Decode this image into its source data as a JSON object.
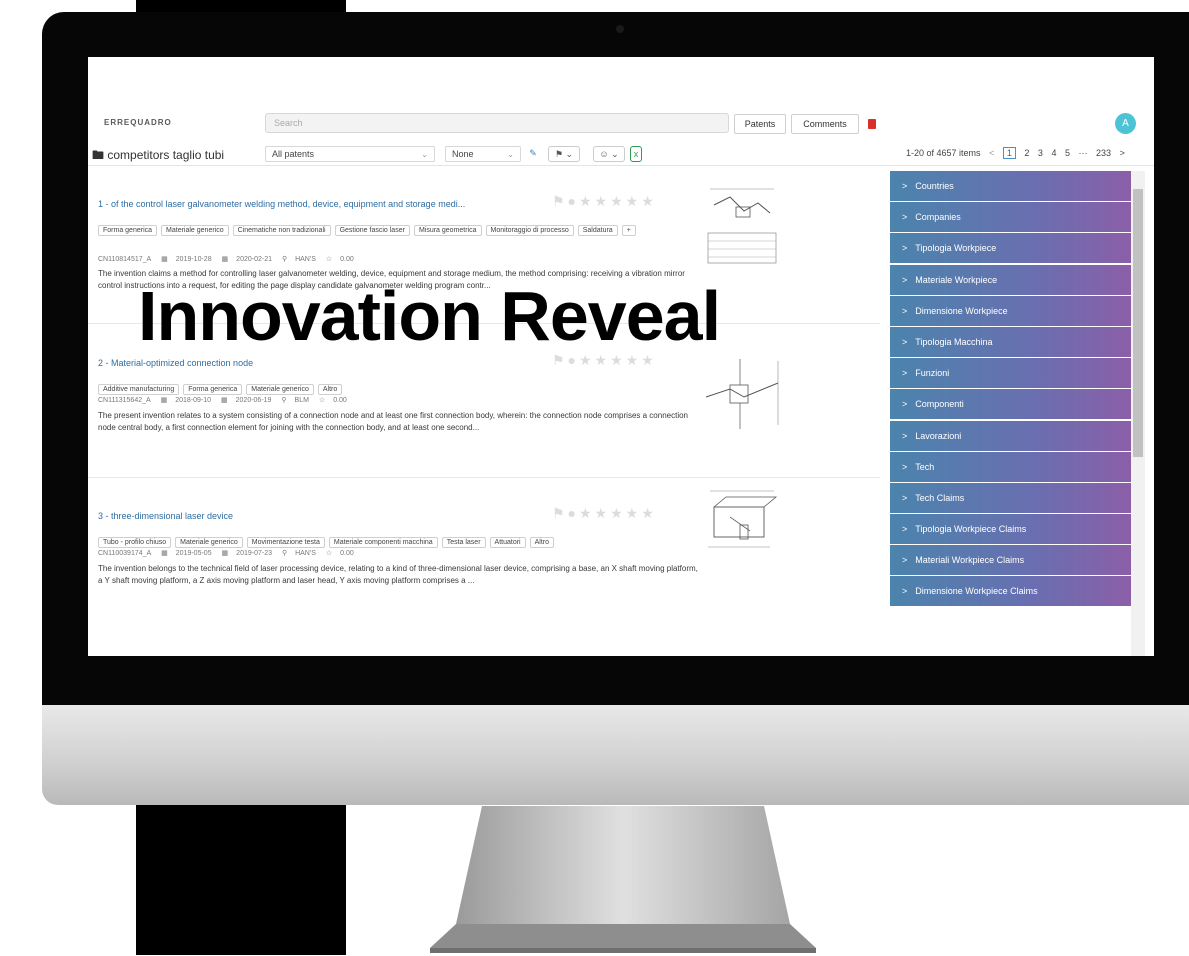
{
  "app": {
    "logo": "ERREQUADRO"
  },
  "header": {
    "search_placeholder": "Search",
    "patents_button": "Patents",
    "comments_button": "Comments",
    "avatar_initial": "A"
  },
  "toolbar": {
    "folder_name": "competitors taglio tubi",
    "filter_select": "All patents",
    "sort_select": "None",
    "pagination": {
      "summary": "1-20 of 4657 items",
      "prev": "<",
      "pages": [
        "1",
        "2",
        "3",
        "4",
        "5"
      ],
      "current": "1",
      "ellipsis": "···",
      "last": "233",
      "next": ">"
    }
  },
  "patents": [
    {
      "title": "1 - of the control laser galvanometer welding method, device, equipment and storage medi...",
      "tags": [
        "Forma generica",
        "Materiale generico",
        "Cinematiche non tradizionali",
        "Gestione fascio laser",
        "Misura geometrica",
        "Monitoraggio di processo",
        "Saldatura",
        "+"
      ],
      "number": "CN110814517_A",
      "filed": "2019-10-28",
      "published": "2020-02-21",
      "owner": "HAN'S",
      "score": "0.00",
      "abstract": "The invention claims a method for controlling laser galvanometer welding, device, equipment and storage medium, the method comprising: receiving a vibration mirror control instructions into a request, for editing the page display candidate galvanometer welding program contr..."
    },
    {
      "title": "2 - Material-optimized connection node",
      "tags": [
        "Additive manufacturing",
        "Forma generica",
        "Materiale generico",
        "Altro"
      ],
      "number": "CN111315642_A",
      "filed": "2018-09-10",
      "published": "2020-06-19",
      "owner": "BLM",
      "score": "0.00",
      "abstract": "The present invention relates to a system consisting of a connection node and at least one first connection body, wherein: the connection node comprises a connection node central body, a first connection element for joining with the connection body, and at least one second..."
    },
    {
      "title": "3 - three-dimensional laser device",
      "tags": [
        "Tubo - profilo chiuso",
        "Materiale generico",
        "Movimentazione testa",
        "Materiale componenti macchina",
        "Testa laser",
        "Attuatori",
        "Altro"
      ],
      "number": "CN110039174_A",
      "filed": "2019-05-05",
      "published": "2019-07-23",
      "owner": "HAN'S",
      "score": "0.00",
      "abstract": "The invention belongs to the technical field of laser processing device, relating to a kind of three-dimensional laser device, comprising a base, an X shaft moving platform, a Y shaft moving platform, a Z axis moving platform and laser head, Y axis moving platform comprises a ..."
    }
  ],
  "sidebar": {
    "items": [
      "Countries",
      "Companies",
      "Tipologia Workpiece",
      "Materiale Workpiece",
      "Dimensione Workpiece",
      "Tipologia Macchina",
      "Funzioni",
      "Componenti",
      "Lavorazioni",
      "Tech",
      "Tech Claims",
      "Tipologia Workpiece Claims",
      "Materiali Workpiece Claims",
      "Dimensione Workpiece Claims"
    ]
  },
  "overlay_text": "Innovation Reveal",
  "colors": {
    "accent": "#2e6da4",
    "sidebar_start": "#4b84ad",
    "sidebar_end": "#8b5fa8",
    "avatar": "#4fc3d6"
  }
}
